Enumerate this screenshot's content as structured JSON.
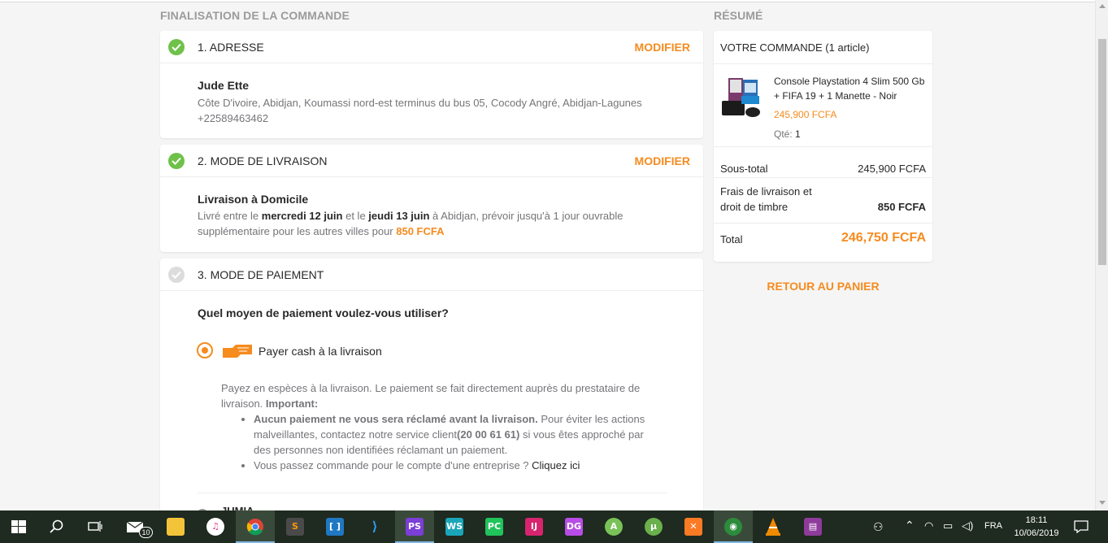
{
  "checkout": {
    "section_title": "FINALISATION DE LA COMMANDE",
    "address": {
      "title": "1. ADRESSE",
      "modify": "MODIFIER",
      "name": "Jude Ette",
      "line": "Côte D'ivoire, Abidjan, Koumassi nord-est terminus du bus 05, Cocody Angré, Abidjan-Lagunes",
      "phone": "+22589463462"
    },
    "delivery": {
      "title": "2. MODE DE LIVRAISON",
      "modify": "MODIFIER",
      "method": "Livraison à Domicile",
      "t1": "Livré entre le ",
      "d1": "mercredi 12 juin",
      "t2": " et le ",
      "d2": "jeudi 13 juin",
      "t3": " à Abidjan, prévoir jusqu'à 1 jour ouvrable supplémentaire pour les autres villes pour ",
      "fee": "850 FCFA"
    },
    "payment": {
      "title": "3. MODE DE PAIEMENT",
      "question": "Quel moyen de paiement voulez-vous utiliser?",
      "option": "Payer cash à la livraison",
      "desc": "Payez en espèces à la livraison. Le paiement se fait directement auprès du prestataire de livraison. ",
      "important": "Important:",
      "b1_bold": "Aucun paiement ne vous sera réclamé avant la livraison.",
      "b1_a": " Pour éviter les actions malveillantes, contactez notre service client",
      "b1_phone": "(20 00 61 61)",
      "b1_b": " si vous êtes approché par des personnes non identifiées réclamant un paiement.",
      "b2": "Vous passez commande pour le compte d'une entreprise ? ",
      "b2_link": "Cliquez ici",
      "next_option_partial": "JUMIA"
    }
  },
  "summary": {
    "section_title": "RÉSUMÉ",
    "order_label": "VOTRE COMMANDE",
    "order_count": "(1 article)",
    "item_name": "Console Playstation 4 Slim 500 Gb + FIFA 19 + 1 Manette - Noir",
    "item_price": "245,900 FCFA",
    "qty_label": "Qté:",
    "qty": "1",
    "subtotal_label": "Sous-total",
    "subtotal": "245,900 FCFA",
    "shipping_label": "Frais de livraison et droit de timbre",
    "shipping": "850 FCFA",
    "total_label": "Total",
    "total": "246,750 FCFA",
    "back_link": "RETOUR AU PANIER"
  },
  "taskbar": {
    "mail_badge": "10",
    "apps": [
      "windows-start",
      "search",
      "task-view",
      "mail",
      "file-explorer",
      "itunes",
      "chrome",
      "sublime-text",
      "brackets",
      "vscode",
      "phpstorm",
      "webstorm",
      "pycharm",
      "intellij",
      "datagrip",
      "android-studio",
      "utorrent",
      "xampp",
      "network-app",
      "vlc",
      "winrar"
    ],
    "lang": "FRA",
    "time": "18:11",
    "date": "10/06/2019"
  },
  "colors": {
    "accent": "#f68b1e",
    "check": "#6fc149",
    "background": "#f5f5f5"
  }
}
